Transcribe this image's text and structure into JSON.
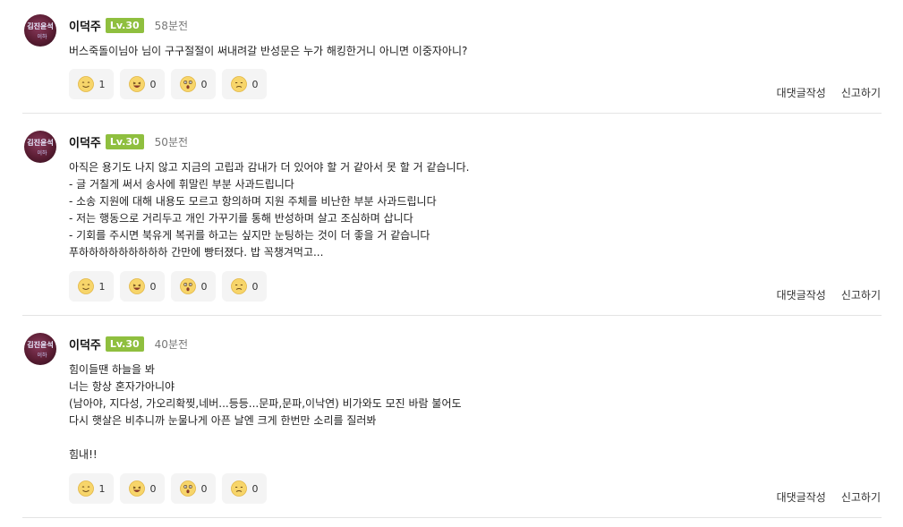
{
  "comments": [
    {
      "author": "이덕주",
      "level": "Lv.30",
      "time": "58분전",
      "body": [
        "버스죽돌이님아 님이 구구절절이 써내려갈 반성문은 누가 해킹한거니 아니면 이중자아니?"
      ],
      "reactions": [
        {
          "icon": "smile-emoji-icon",
          "count": "1"
        },
        {
          "icon": "laugh-emoji-icon",
          "count": "0"
        },
        {
          "icon": "surprised-emoji-icon",
          "count": "0"
        },
        {
          "icon": "sad-emoji-icon",
          "count": "0"
        }
      ],
      "reply_label": "대댓글작성",
      "report_label": "신고하기"
    },
    {
      "author": "이덕주",
      "level": "Lv.30",
      "time": "50분전",
      "body": [
        "아직은 용기도 나지 않고 지금의 고립과 감내가 더 있어야 할 거 같아서 못 할 거 같습니다.",
        "- 글 거칠게 써서 송사에 휘말린 부분 사과드립니다",
        "- 소송 지원에 대해 내용도 모르고 항의하며 지원 주체를 비난한 부분 사과드립니다",
        "- 저는 행동으로 거리두고 개인 가꾸기를 통해 반성하며 살고 조심하며 삽니다",
        "- 기회를 주시면 북유게 복귀를 하고는 싶지만 눈팅하는 것이 더 좋을 거 같습니다",
        "푸하하하하하하하하하 간만에 빵터졌다. 밥 꼭챙겨먹고..."
      ],
      "reactions": [
        {
          "icon": "smile-emoji-icon",
          "count": "1"
        },
        {
          "icon": "laugh-emoji-icon",
          "count": "0"
        },
        {
          "icon": "surprised-emoji-icon",
          "count": "0"
        },
        {
          "icon": "sad-emoji-icon",
          "count": "0"
        }
      ],
      "reply_label": "대댓글작성",
      "report_label": "신고하기"
    },
    {
      "author": "이덕주",
      "level": "Lv.30",
      "time": "40분전",
      "body": [
        "힘이들땐 하늘을 봐",
        "너는 항상 혼자가아니야",
        "(남아야, 지다성, 가오리확찢,네버...등등...문파,문파,이낙연) 비가와도 모진 바람 불어도",
        "다시 햇살은 비추니까 눈물나게 아픈 날엔 크게 한번만 소리를 질러봐",
        "",
        "힘내!!"
      ],
      "reactions": [
        {
          "icon": "smile-emoji-icon",
          "count": "1"
        },
        {
          "icon": "laugh-emoji-icon",
          "count": "0"
        },
        {
          "icon": "surprised-emoji-icon",
          "count": "0"
        },
        {
          "icon": "sad-emoji-icon",
          "count": "0"
        }
      ],
      "reply_label": "대댓글작성",
      "report_label": "신고하기"
    }
  ],
  "avatar_text": [
    "김진윤석",
    "이하"
  ],
  "colors": {
    "level_badge": "#8fbf3f",
    "divider": "#e4e4e4",
    "reaction_bg": "#f4f4f4"
  }
}
